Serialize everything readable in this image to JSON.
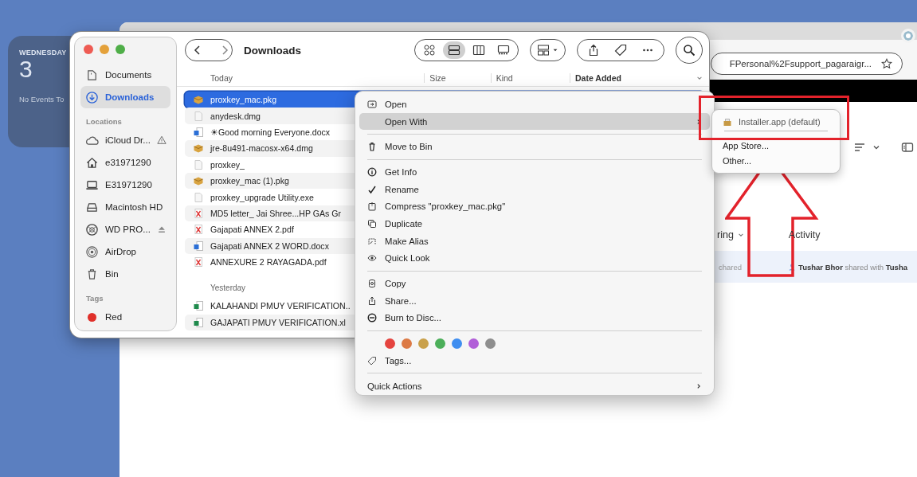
{
  "calendar_widget": {
    "weekday": "WEDNESDAY",
    "day": "3",
    "events": "No Events To"
  },
  "browser": {
    "url": "FPersonal%2Fsupport_pagaraigr...",
    "tabs": [
      {
        "label": "ring",
        "dropdown": true
      },
      {
        "label": "Activity",
        "dropdown": false
      }
    ],
    "activity": {
      "status": "chared",
      "text": "**Tushar Bhor** shared with **Tusha**"
    }
  },
  "finder": {
    "title": "Downloads",
    "view_modes": [
      {
        "selected": false
      },
      {
        "selected": true
      },
      {
        "selected": false
      },
      {
        "selected": false
      }
    ],
    "sidebar": [
      {
        "items": [
          {
            "label": "Documents",
            "selected": false
          },
          {
            "label": "Downloads",
            "selected": true
          }
        ]
      },
      {
        "header": "Locations",
        "items": [
          {
            "label": "iCloud Dr...",
            "selected": false,
            "warning": true
          },
          {
            "label": "e31971290",
            "selected": false
          },
          {
            "label": "E31971290",
            "selected": false
          },
          {
            "label": "Macintosh HD",
            "selected": false
          },
          {
            "label": "WD PRO...",
            "selected": false,
            "ejectable": true
          },
          {
            "label": "AirDrop",
            "selected": false
          },
          {
            "label": "Bin",
            "selected": false
          }
        ]
      },
      {
        "header": "Tags",
        "items": [
          {
            "label": "Red",
            "selected": false,
            "color": "#e0302a"
          }
        ]
      }
    ],
    "columns": [
      "Size",
      "Kind",
      "Date Added"
    ],
    "groups": [
      {
        "label": "Today",
        "files": [
          {
            "name": "proxkey_mac.pkg",
            "kind": "pkg",
            "selected": true
          },
          {
            "name": "anydesk.dmg",
            "kind": "file",
            "selected": false
          },
          {
            "name": "☀Good morning Everyone.docx",
            "kind": "docx",
            "selected": false
          },
          {
            "name": "jre-8u491-macosx-x64.dmg",
            "kind": "pkg",
            "selected": false
          },
          {
            "name": "proxkey_",
            "kind": "file",
            "selected": false
          },
          {
            "name": "proxkey_mac (1).pkg",
            "kind": "pkg",
            "selected": false
          },
          {
            "name": "proxkey_upgrade Utility.exe",
            "kind": "file",
            "selected": false
          },
          {
            "name": "MD5 letter_ Jai Shree...HP GAs Gr",
            "kind": "pdf",
            "selected": false
          },
          {
            "name": "Gajapati ANNEX 2.pdf",
            "kind": "pdf",
            "selected": false
          },
          {
            "name": "Gajapati ANNEX 2 WORD.docx",
            "kind": "docx",
            "selected": false
          },
          {
            "name": "ANNEXURE 2 RAYAGADA.pdf",
            "kind": "pdf",
            "selected": false
          }
        ]
      },
      {
        "label": "Yesterday",
        "files": [
          {
            "name": "KALAHANDI PMUY VERIFICATION..",
            "kind": "xlsx",
            "selected": false
          },
          {
            "name": "GAJAPATI PMUY VERIFICATION.xl",
            "kind": "xlsx",
            "selected": false
          }
        ]
      }
    ]
  },
  "context_menu": {
    "sections": [
      [
        {
          "kind": "command",
          "label": "Open",
          "selected": false,
          "submenu": false
        },
        {
          "kind": "command",
          "label": "Open With",
          "selected": true,
          "submenu": true
        }
      ],
      [
        {
          "kind": "command",
          "label": "Move to Bin",
          "selected": false,
          "submenu": false
        }
      ],
      [
        {
          "kind": "command",
          "label": "Get Info",
          "selected": false,
          "submenu": false
        },
        {
          "kind": "command",
          "label": "Rename",
          "selected": false,
          "submenu": false
        },
        {
          "kind": "command",
          "label": "Compress \"proxkey_mac.pkg\"",
          "selected": false,
          "submenu": false
        },
        {
          "kind": "command",
          "label": "Duplicate",
          "selected": false,
          "submenu": false
        },
        {
          "kind": "command",
          "label": "Make Alias",
          "selected": false,
          "submenu": false
        },
        {
          "kind": "command",
          "label": "Quick Look",
          "selected": false,
          "submenu": false
        }
      ],
      [
        {
          "kind": "command",
          "label": "Copy",
          "selected": false,
          "submenu": false
        },
        {
          "kind": "command",
          "label": "Share...",
          "selected": false,
          "submenu": false
        },
        {
          "kind": "command",
          "label": "Burn to Disc...",
          "selected": false,
          "submenu": false
        }
      ],
      [
        {
          "kind": "tag_colors",
          "colors": [
            {
              "color": "#e5443f"
            },
            {
              "color": "#dc7a45"
            },
            {
              "color": "#c9a04a"
            },
            {
              "color": "#4caf5a"
            },
            {
              "color": "#3f8ef0"
            },
            {
              "color": "#b15ed8"
            },
            {
              "color": "#8e8e8e"
            }
          ]
        },
        {
          "kind": "command",
          "label": "Tags...",
          "selected": false,
          "submenu": false
        }
      ],
      [
        {
          "kind": "command",
          "label": "Quick Actions",
          "selected": false,
          "submenu": true
        }
      ]
    ]
  },
  "open_with_menu": {
    "sections": [
      [
        {
          "label": "Installer.app (default)",
          "default": true
        }
      ],
      [
        {
          "label": "App Store...",
          "default": false
        },
        {
          "label": "Other...",
          "default": false
        }
      ]
    ]
  }
}
